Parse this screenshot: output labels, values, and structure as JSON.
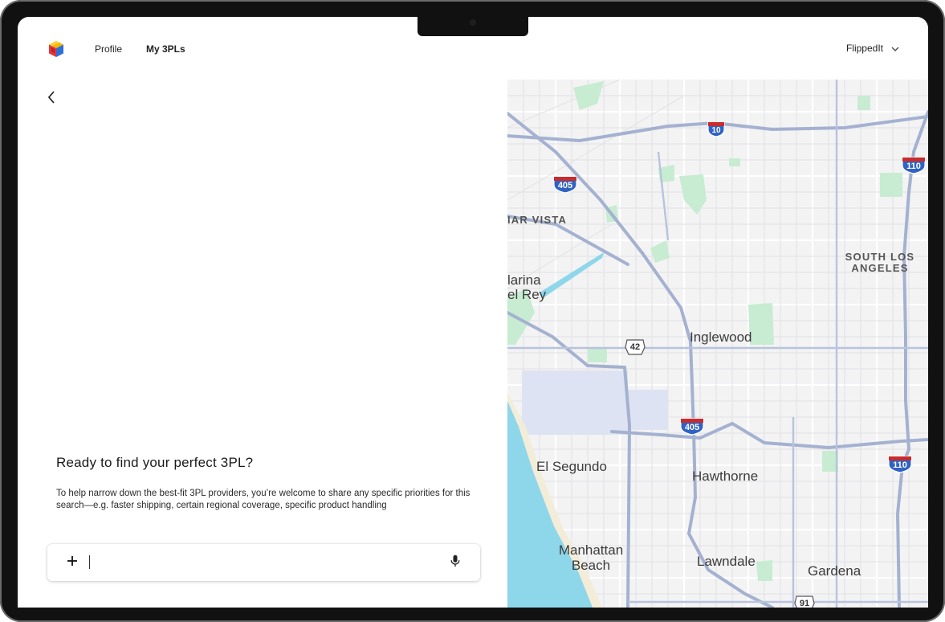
{
  "nav": {
    "links": [
      "Profile",
      "My 3PLs"
    ],
    "account_name": "FlippedIt"
  },
  "panel": {
    "title": "Ready to find your perfect 3PL?",
    "description": "To help narrow down the best-fit 3PL providers, you’re welcome to share any specific priorities for this search—e.g. faster shipping, certain regional coverage, specific product handling",
    "input_value": "",
    "input_placeholder": ""
  },
  "map": {
    "places": {
      "mar_vista": "IAR VISTA",
      "south_los_angeles": "SOUTH LOS ANGELES",
      "marina": "larina",
      "del_rey": "el Rey",
      "inglewood": "Inglewood",
      "el_segundo": "El Segundo",
      "hawthorne": "Hawthorne",
      "manhattan_beach": "Manhattan Beach",
      "lawndale": "Lawndale",
      "gardena": "Gardena"
    },
    "shields": {
      "i10": "10",
      "i405_north": "405",
      "i110_north": "110",
      "ca42": "42",
      "i405_south": "405",
      "i110_south": "110",
      "ca91": "91"
    },
    "colors": {
      "background": "#f3f3f4",
      "water": "#8ed6ea",
      "park": "#c7ecd1",
      "highway": "#a4b1d0",
      "airport": "#dde3f2",
      "beach": "#f2ecd8"
    }
  },
  "icons": {
    "logo": "cube-logo-icon",
    "back": "chevron-left-icon",
    "account_menu": "chevron-down-icon",
    "add": "plus-icon",
    "mic": "microphone-icon"
  }
}
